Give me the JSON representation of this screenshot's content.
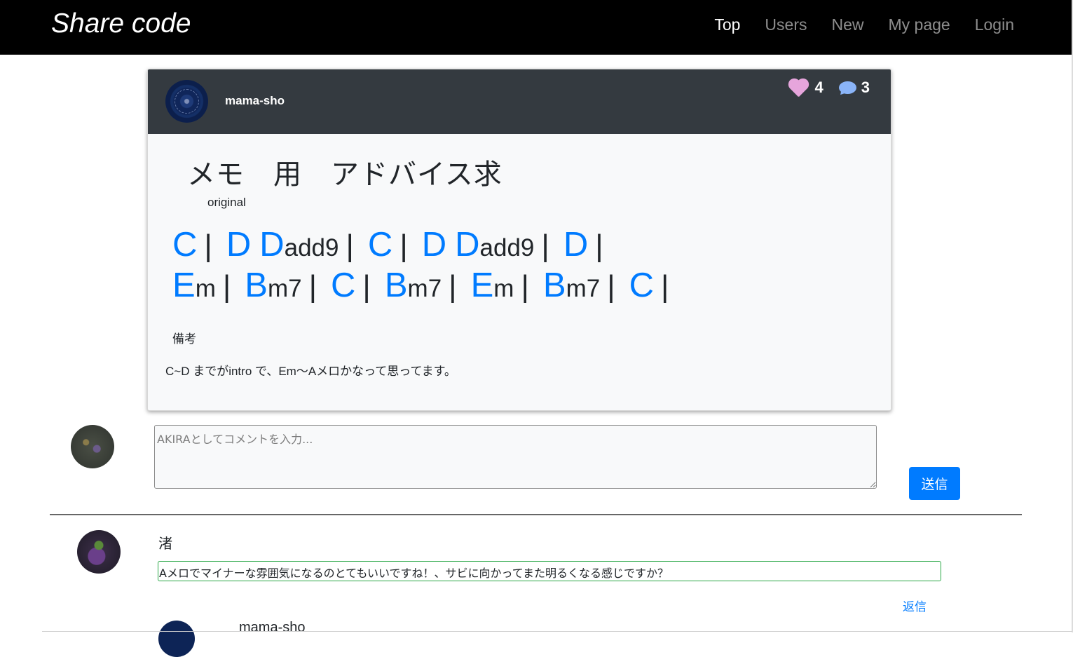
{
  "navbar": {
    "brand": "Share code",
    "items": [
      {
        "label": "Top",
        "active": true
      },
      {
        "label": "Users",
        "active": false
      },
      {
        "label": "New",
        "active": false
      },
      {
        "label": "My page",
        "active": false
      },
      {
        "label": "Login",
        "active": false
      }
    ]
  },
  "post": {
    "author": "mama-sho",
    "likes": "4",
    "comments": "3",
    "title": "メモ　用　アドバイス求",
    "genre": "original",
    "chord_lines": [
      [
        {
          "root": "C",
          "quality": ""
        },
        {
          "root": "D",
          "quality": ""
        },
        {
          "root": "D",
          "quality": "add9",
          "join_next": false
        },
        {
          "root": "C",
          "quality": ""
        },
        {
          "root": "D",
          "quality": ""
        },
        {
          "root": "D",
          "quality": "add9"
        },
        {
          "root": "D",
          "quality": ""
        }
      ],
      [
        {
          "root": "E",
          "quality": "m"
        },
        {
          "root": "B",
          "quality": "m7"
        },
        {
          "root": "C",
          "quality": ""
        },
        {
          "root": "B",
          "quality": "m7"
        },
        {
          "root": "E",
          "quality": "m"
        },
        {
          "root": "B",
          "quality": "m7"
        },
        {
          "root": "C",
          "quality": ""
        }
      ]
    ],
    "memo_label": "備考",
    "memo_text": "C~D までがintro で、Em〜Aメロかなって思ってます。"
  },
  "comment_form": {
    "placeholder": "AKIRAとしてコメントを入力...",
    "value": "",
    "submit_label": "送信"
  },
  "comments": [
    {
      "author": "渚",
      "body": "Aメロでマイナーな雰囲気になるのとてもいいですね！、サビに向かってまた明るくなる感じですか？",
      "reply_label": "返信"
    }
  ],
  "reply": {
    "author": "mama-sho"
  },
  "colors": {
    "navbar": "#000000",
    "accent": "#007bff",
    "card_header": "#343a40",
    "like": "#e6a5dc",
    "comment_icon": "#8ab4f8",
    "comment_border": "#28a745"
  }
}
